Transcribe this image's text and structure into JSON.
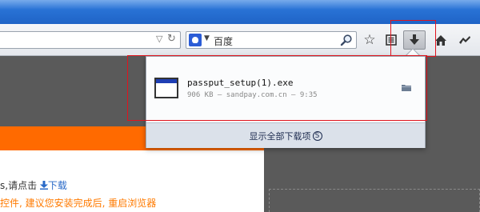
{
  "toolbar": {
    "search_engine_label": "百度",
    "icons": [
      "star-icon",
      "bookmarks-icon",
      "download-icon",
      "home-icon",
      "addon-icon"
    ]
  },
  "download_panel": {
    "file_name": "passput_setup(1).exe",
    "file_meta": "906 KB — sandpay.com.cn — 9:35",
    "show_all_label": "显示全部下载项",
    "show_all_key": "S"
  },
  "page": {
    "line1_prefix": "s,请点击",
    "line1_link": "下载",
    "line2": "控件, 建议您安装完成后, 重启浏览器"
  },
  "colors": {
    "title_bar": "#1f63c6",
    "orange_banner": "#ff6a00",
    "highlight_box": "#e0141e",
    "panel_footer": "#dbe1ea"
  }
}
